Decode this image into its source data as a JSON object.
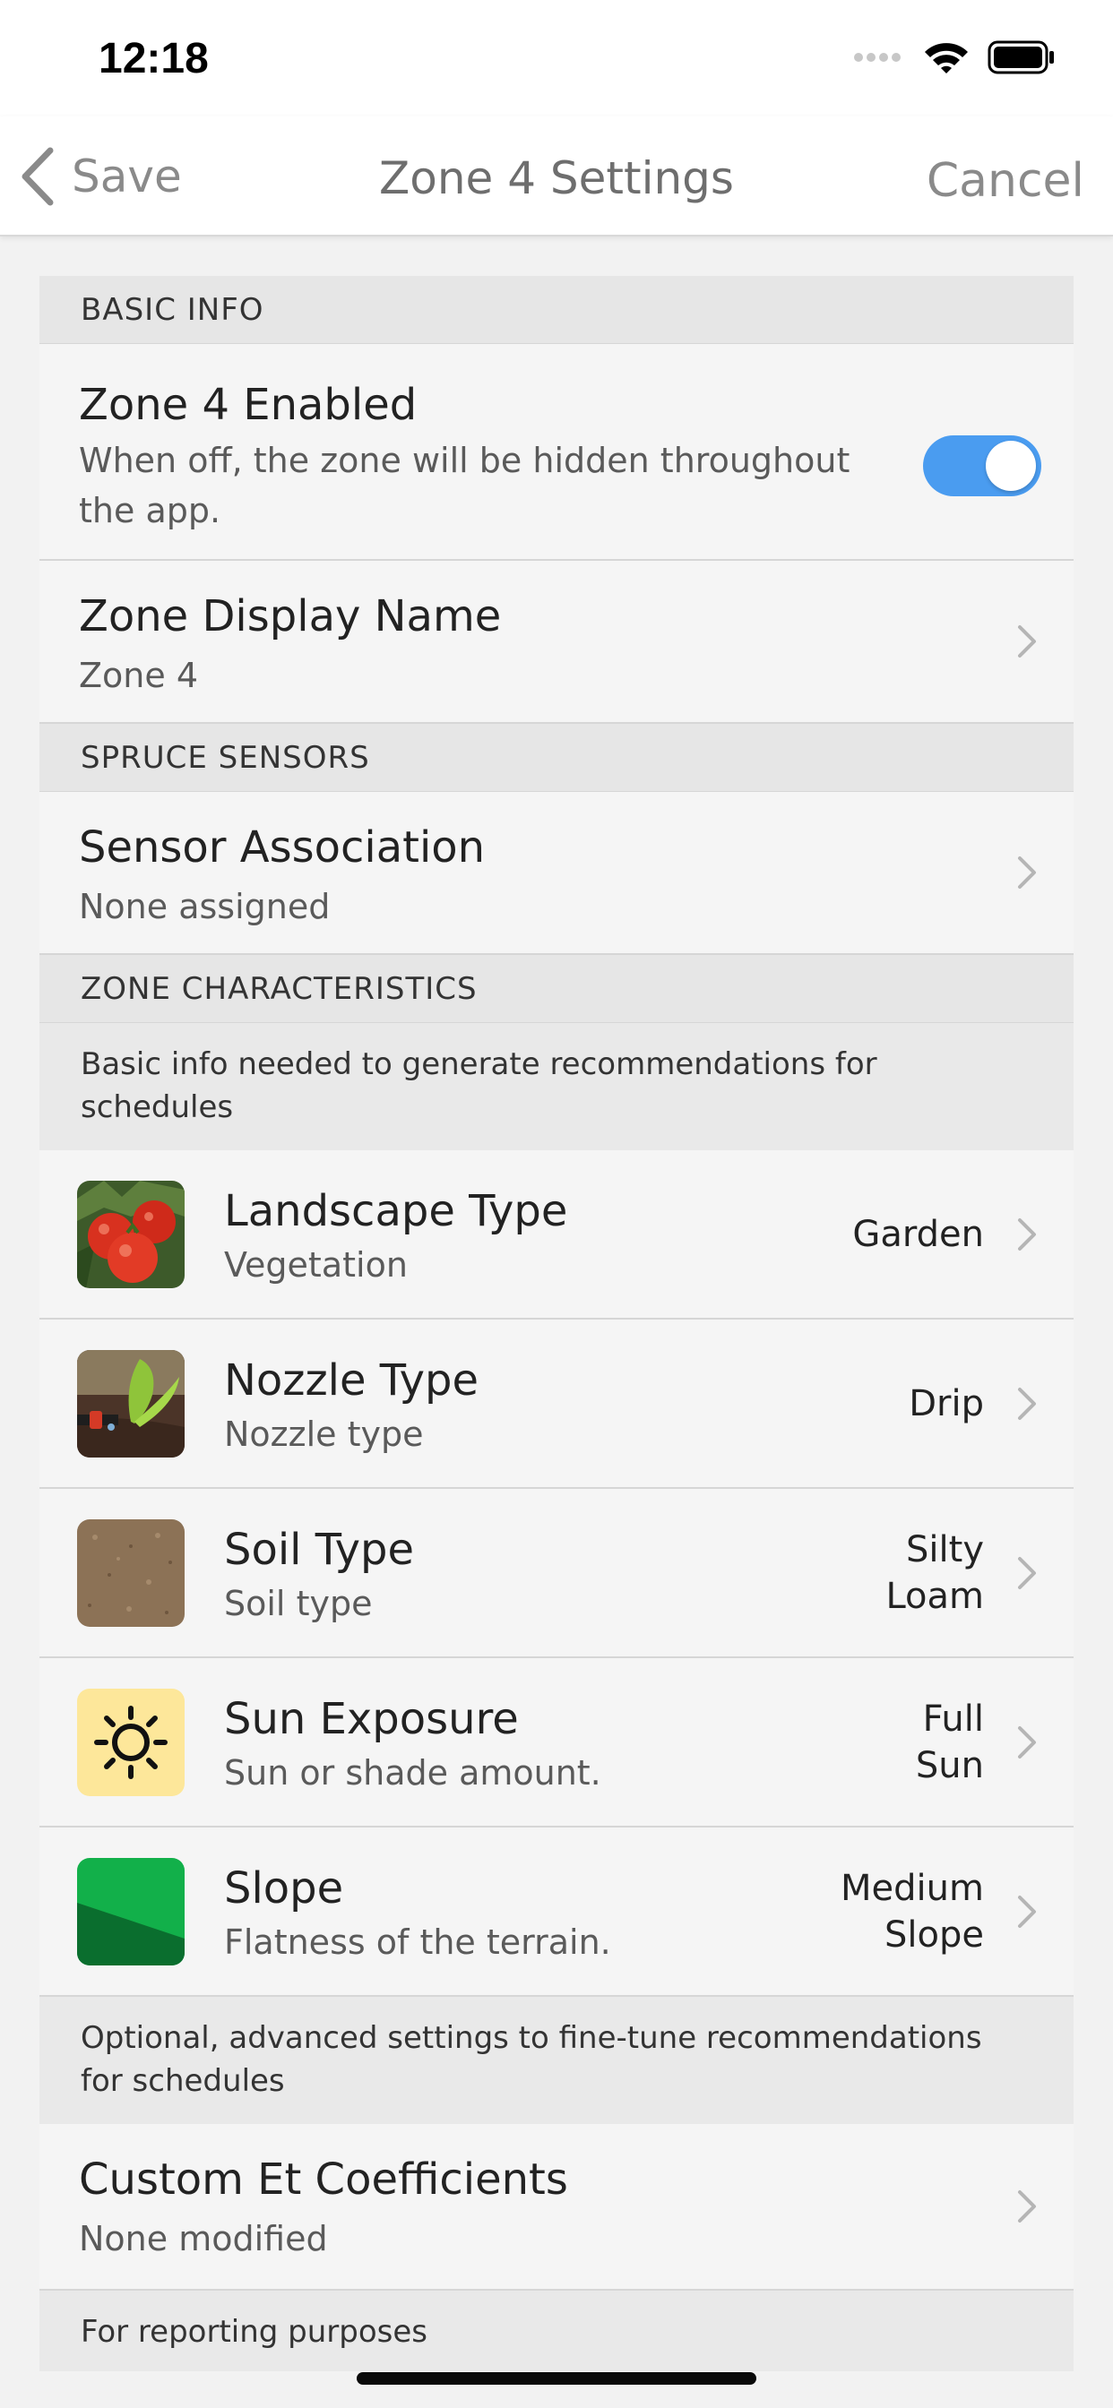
{
  "status_bar": {
    "time": "12:18"
  },
  "nav": {
    "back_label": "Save",
    "title": "Zone 4 Settings",
    "cancel_label": "Cancel"
  },
  "basic_info": {
    "header": "BASIC INFO",
    "enabled": {
      "title": "Zone 4 Enabled",
      "description": "When off, the zone will be hidden throughout the app.",
      "toggle_on": true
    },
    "display_name": {
      "title": "Zone Display Name",
      "value": "Zone 4"
    }
  },
  "sensors": {
    "header": "SPRUCE SENSORS",
    "association": {
      "title": "Sensor Association",
      "value": "None assigned"
    }
  },
  "characteristics": {
    "header": "ZONE CHARACTERISTICS",
    "note": "Basic info needed to generate recommendations for schedules",
    "items": [
      {
        "icon": "tomato-plant-image",
        "title": "Landscape Type",
        "subtitle": "Vegetation",
        "value_lines": [
          "Garden"
        ]
      },
      {
        "icon": "drip-nozzle-image",
        "title": "Nozzle Type",
        "subtitle": "Nozzle type",
        "value_lines": [
          "Drip"
        ]
      },
      {
        "icon": "soil-image",
        "title": "Soil Type",
        "subtitle": "Soil type",
        "value_lines": [
          "Silty",
          "Loam"
        ]
      },
      {
        "icon": "sun-icon",
        "title": "Sun Exposure",
        "subtitle": "Sun or shade amount.",
        "value_lines": [
          "Full",
          "Sun"
        ]
      },
      {
        "icon": "slope-icon",
        "title": "Slope",
        "subtitle": "Flatness of the terrain.",
        "value_lines": [
          "Medium",
          "Slope"
        ]
      }
    ]
  },
  "advanced": {
    "note": "Optional, advanced settings to fine-tune recommendations for schedules",
    "et": {
      "title": "Custom Et Coefficients",
      "value": "None modified"
    }
  },
  "reporting": {
    "note": "For reporting purposes"
  },
  "colors": {
    "toggle_on": "#4a9cf0",
    "sun_bg": "#fde79a",
    "slope_light": "#12b04a",
    "slope_dark": "#0a6e2e"
  }
}
